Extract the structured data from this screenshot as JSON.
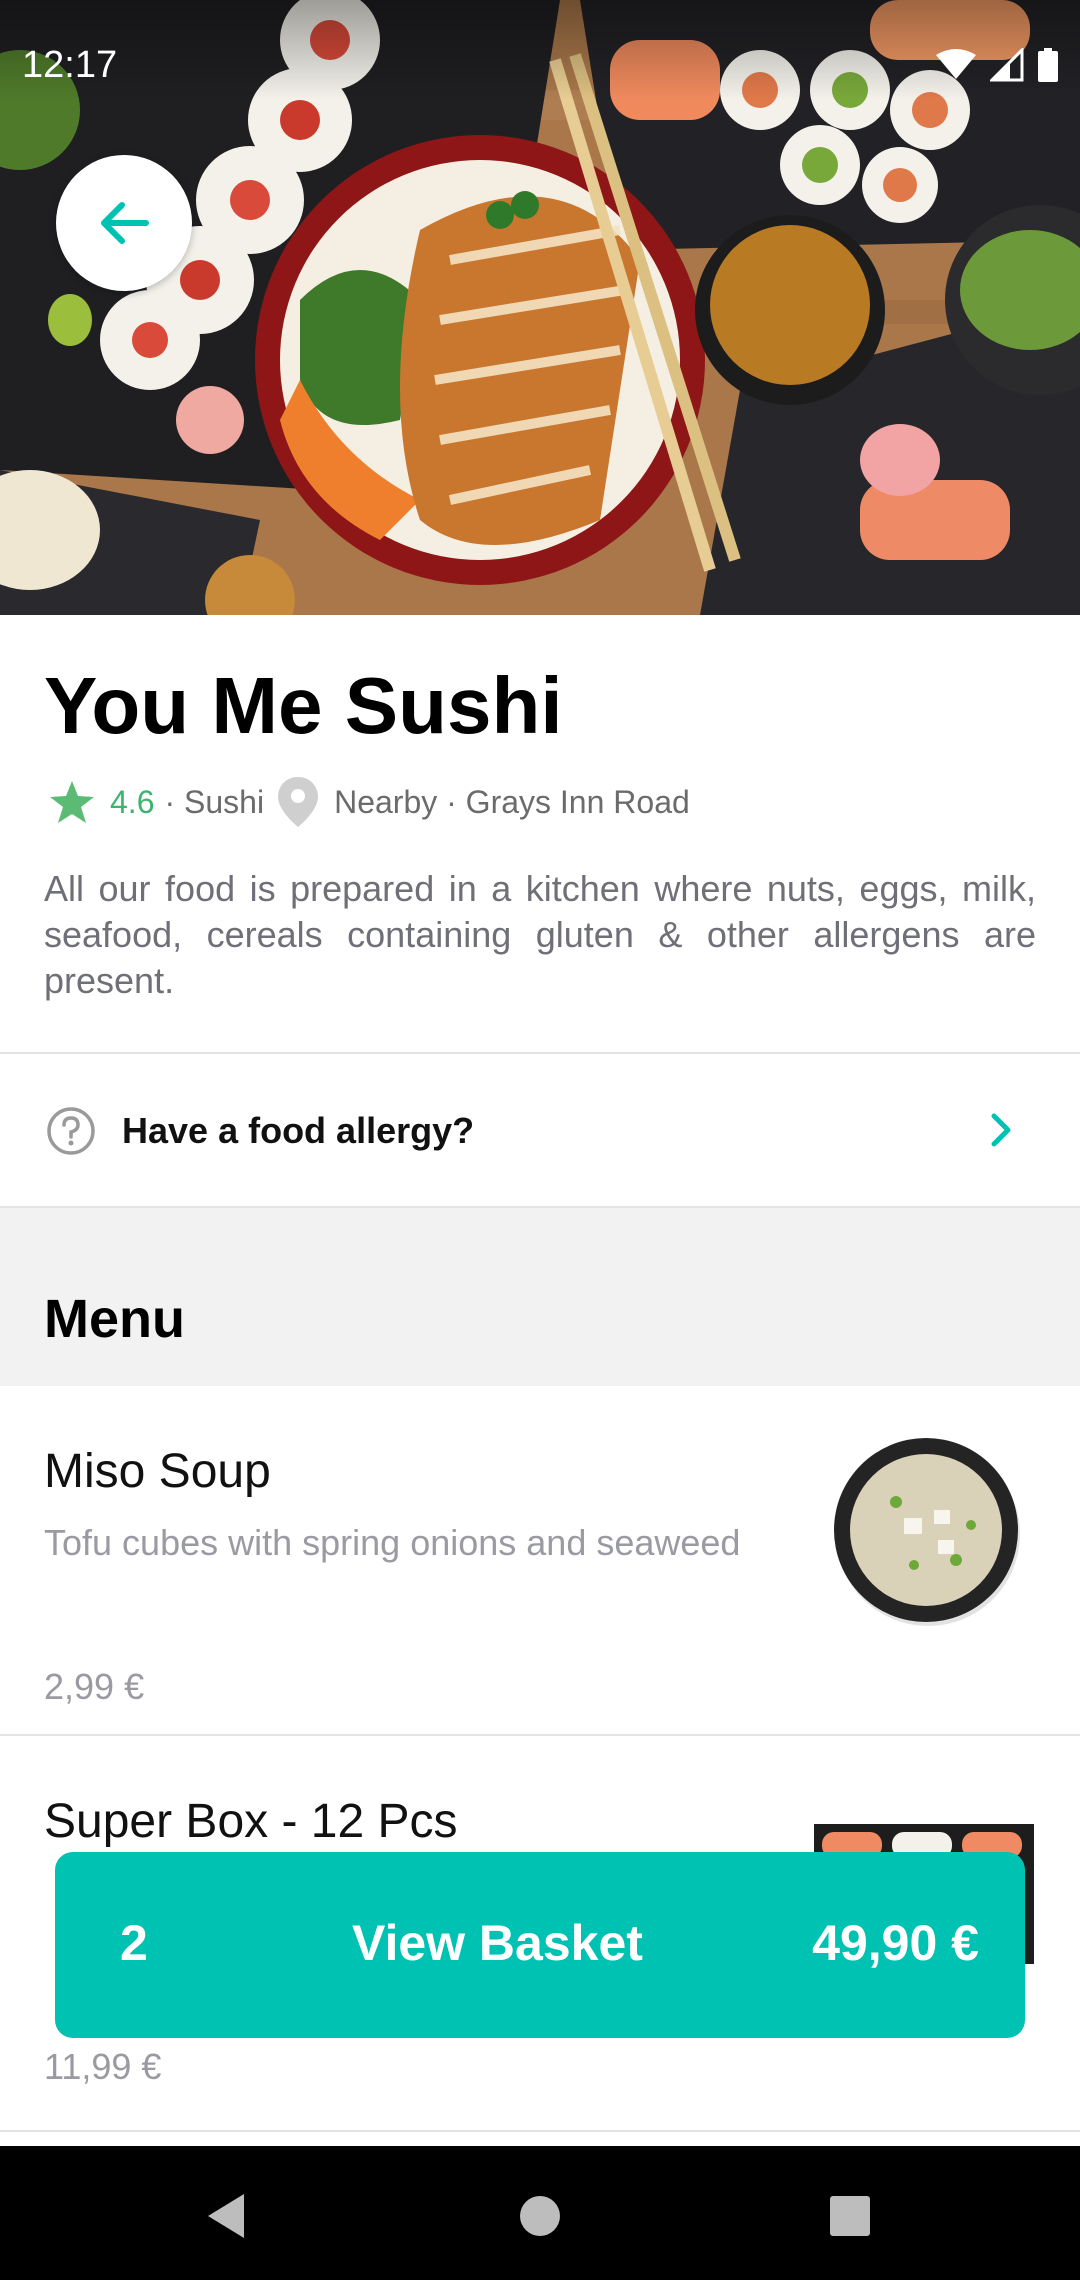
{
  "status_bar": {
    "time": "12:17",
    "icons": [
      "wifi-icon",
      "signal-icon",
      "battery-icon"
    ]
  },
  "hero": {
    "image": "sushi-and-katsu-bowl-photo",
    "back_icon": "arrow-left-icon"
  },
  "restaurant": {
    "name": "You Me Sushi",
    "rating": "4.6",
    "category": "· Sushi",
    "location": "Nearby · Grays Inn Road",
    "description": "All our food is prepared in a kitchen where nuts, eggs, milk, seafood, cereals containing gluten & other allergens are present."
  },
  "allergy": {
    "label": "Have a food allergy?",
    "icon": "question-circle-icon",
    "chevron": "chevron-right-icon"
  },
  "menu": {
    "title": "Menu",
    "items": [
      {
        "name": "Miso Soup",
        "description": "Tofu cubes with spring onions and seaweed",
        "price": "2,99 €",
        "image": "miso-soup-bowl"
      },
      {
        "name": "Super Box - 12 Pcs",
        "description": "",
        "price": "11,99 €",
        "image": "sushi-box"
      }
    ]
  },
  "basket": {
    "count": "2",
    "label": "View Basket",
    "total": "49,90 €"
  },
  "colors": {
    "accent": "#00c2b3",
    "rating_green": "#3cb46e",
    "muted_text": "#9a9aa2"
  },
  "nav_bar": {
    "icons": [
      "nav-back-icon",
      "nav-home-icon",
      "nav-recents-icon"
    ]
  }
}
